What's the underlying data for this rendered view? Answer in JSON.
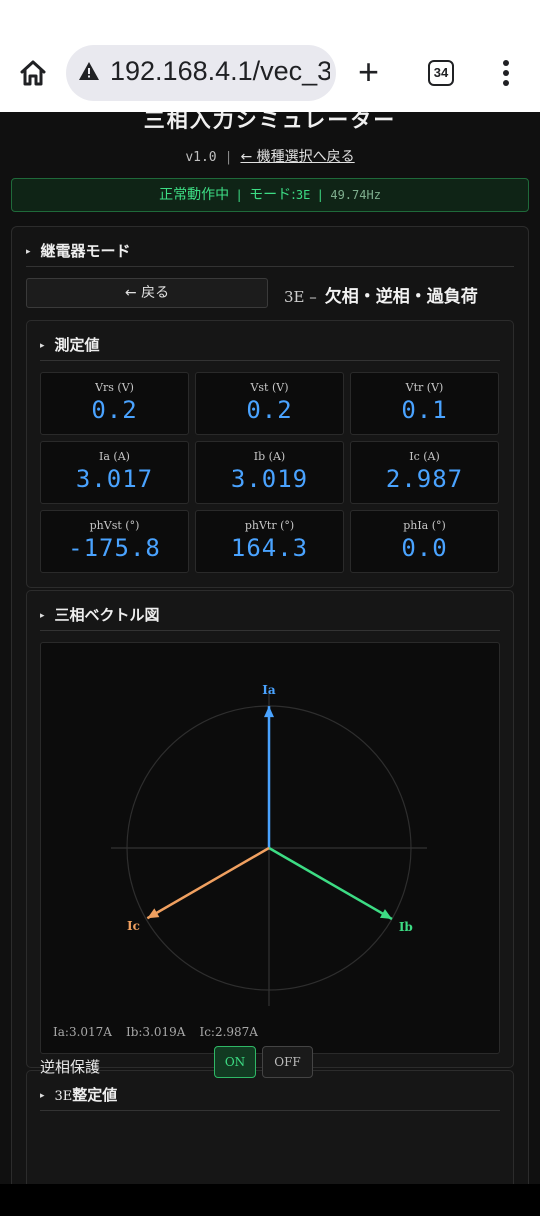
{
  "browser": {
    "url": "192.168.4.1/vec_3",
    "tab_count": "34",
    "home_icon": "home-icon",
    "warning_icon": "warning-triangle-icon",
    "new_tab_icon": "plus-icon",
    "menu_icon": "more-vert-icon"
  },
  "header": {
    "title": "三相入力シミュレーター",
    "version": "v1.0",
    "separator": "|",
    "back_link": "← 機種選択へ戻る"
  },
  "status": {
    "state": "正常動作中",
    "mode_label": "モード:",
    "mode_value": "3E",
    "frequency": "49.74Hz",
    "accent": "#3ddc84"
  },
  "relay_section": {
    "heading": "継電器モード",
    "back_button": "← 戻る",
    "mode_code": "3E –",
    "mode_name": "欠相・逆相・過負荷"
  },
  "measurements": {
    "heading": "測定値",
    "value_color": "#4aa3ff",
    "cells": [
      {
        "label": "Vrs (V)",
        "value": "0.2"
      },
      {
        "label": "Vst (V)",
        "value": "0.2"
      },
      {
        "label": "Vtr (V)",
        "value": "0.1"
      },
      {
        "label": "Ia (A)",
        "value": "3.017"
      },
      {
        "label": "Ib (A)",
        "value": "3.019"
      },
      {
        "label": "Ic (A)",
        "value": "2.987"
      },
      {
        "label": "phVst (°)",
        "value": "-175.8"
      },
      {
        "label": "phVtr (°)",
        "value": "164.3"
      },
      {
        "label": "phIa (°)",
        "value": "0.0"
      }
    ]
  },
  "vector_diagram": {
    "heading": "三相ベクトル図",
    "vectors": [
      {
        "name": "Ia",
        "magnitude": 3.017,
        "angle_deg": 0,
        "color": "#4aa3ff"
      },
      {
        "name": "Ib",
        "magnitude": 3.019,
        "angle_deg": -120,
        "color": "#3ddc84"
      },
      {
        "name": "Ic",
        "magnitude": 2.987,
        "angle_deg": 120,
        "color": "#f0a060"
      }
    ],
    "readout": {
      "ia": "Ia:3.017A",
      "ib": "Ib:3.019A",
      "ic": "Ic:2.987A"
    }
  },
  "settings": {
    "heading_code": "3E",
    "heading": "整定値",
    "reverse_phase_label": "逆相保護",
    "on_label": "ON",
    "off_label": "OFF"
  }
}
